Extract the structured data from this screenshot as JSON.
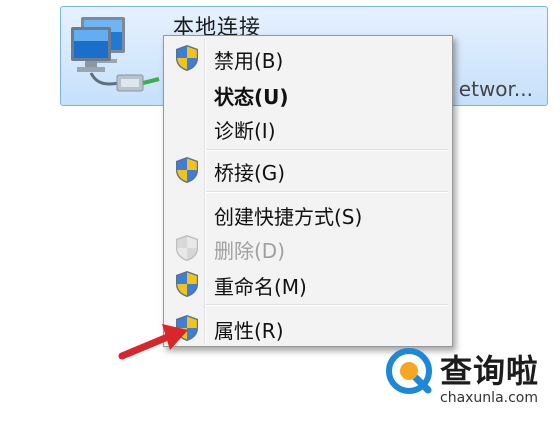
{
  "connection": {
    "name": "本地连接",
    "device_truncated": "etwor..."
  },
  "context_menu": {
    "items": [
      {
        "label": "禁用(B)",
        "shield": true,
        "bold": false,
        "disabled": false
      },
      {
        "label": "状态(U)",
        "shield": false,
        "bold": true,
        "disabled": false
      },
      {
        "label": "诊断(I)",
        "shield": false,
        "bold": false,
        "disabled": false
      },
      {
        "label": "桥接(G)",
        "shield": true,
        "bold": false,
        "disabled": false
      },
      {
        "label": "创建快捷方式(S)",
        "shield": false,
        "bold": false,
        "disabled": false
      },
      {
        "label": "删除(D)",
        "shield": true,
        "bold": false,
        "disabled": true
      },
      {
        "label": "重命名(M)",
        "shield": true,
        "bold": false,
        "disabled": false
      },
      {
        "label": "属性(R)",
        "shield": true,
        "bold": false,
        "disabled": false
      }
    ]
  },
  "watermark": {
    "title": "查询啦",
    "url": "chaxunla.com"
  },
  "colors": {
    "tile_border": "#7eb4ea",
    "arrow": "#d9262b",
    "watermark_blue": "#1e88d8",
    "watermark_orange": "#f5a623"
  }
}
